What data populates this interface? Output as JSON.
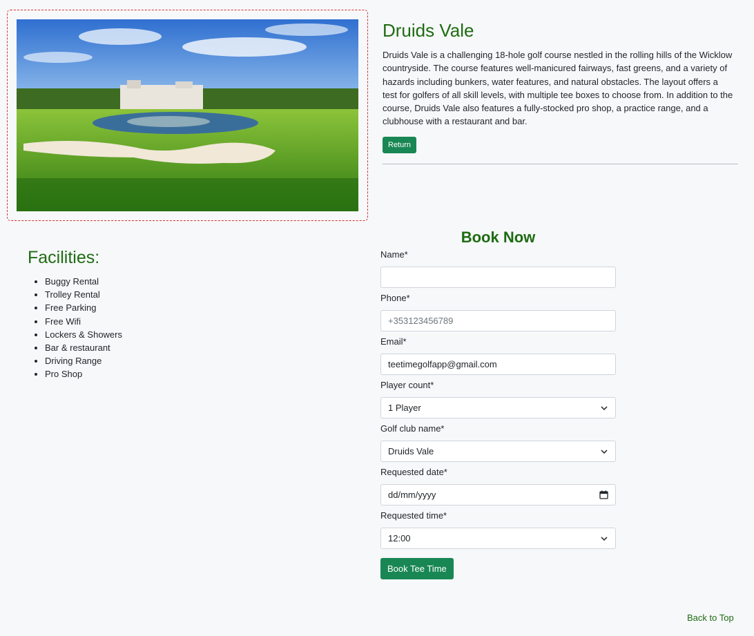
{
  "course": {
    "title": "Druids Vale",
    "description": "Druids Vale is a challenging 18-hole golf course nestled in the rolling hills of the Wicklow countryside. The course features well-manicured fairways, fast greens, and a variety of hazards including bunkers, water features, and natural obstacles. The layout offers a test for golfers of all skill levels, with multiple tee boxes to choose from. In addition to the course, Druids Vale also features a fully-stocked pro shop, a practice range, and a clubhouse with a restaurant and bar.",
    "return_label": "Return"
  },
  "facilities": {
    "title": "Facilities:",
    "items": [
      "Buggy Rental",
      "Trolley Rental",
      "Free Parking",
      "Free Wifi",
      "Lockers & Showers",
      "Bar & restaurant",
      "Driving Range",
      "Pro Shop"
    ]
  },
  "booking": {
    "title": "Book Now",
    "name_label": "Name*",
    "name_value": "",
    "phone_label": "Phone*",
    "phone_placeholder": "+353123456789",
    "email_label": "Email*",
    "email_value": "teetimegolfapp@gmail.com",
    "players_label": "Player count*",
    "players_value": "1 Player",
    "club_label": "Golf club name*",
    "club_value": "Druids Vale",
    "date_label": "Requested date*",
    "date_placeholder": "dd/mm/yyyy",
    "time_label": "Requested time*",
    "time_value": "12:00",
    "submit_label": "Book Tee Time"
  },
  "footer": {
    "back_to_top": "Back to Top"
  },
  "colors": {
    "accent_green": "#198754",
    "heading_green": "#1e6b12",
    "frame_red": "#d62f2f"
  },
  "icons": [
    "chevron-down-icon",
    "calendar-icon"
  ]
}
